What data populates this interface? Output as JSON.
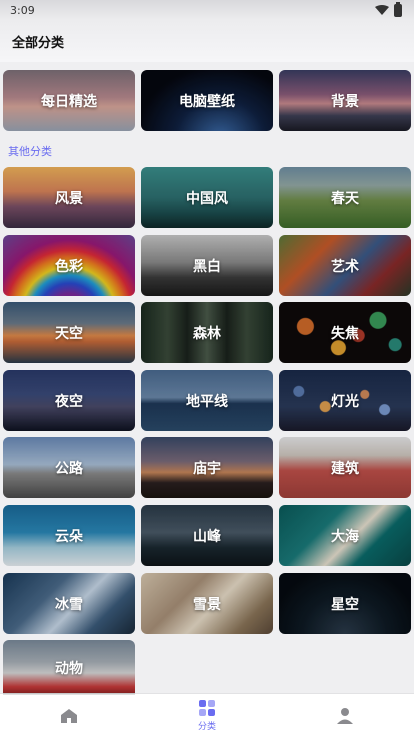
{
  "status_bar": {
    "time": "3:09"
  },
  "header": {
    "title": "全部分类"
  },
  "featured": [
    {
      "label": "每日精选"
    },
    {
      "label": "电脑壁纸"
    },
    {
      "label": "背景"
    }
  ],
  "section_label": "其他分类",
  "categories": [
    {
      "label": "风景"
    },
    {
      "label": "中国风"
    },
    {
      "label": "春天"
    },
    {
      "label": "色彩"
    },
    {
      "label": "黑白"
    },
    {
      "label": "艺术"
    },
    {
      "label": "天空"
    },
    {
      "label": "森林"
    },
    {
      "label": "失焦"
    },
    {
      "label": "夜空"
    },
    {
      "label": "地平线"
    },
    {
      "label": "灯光"
    },
    {
      "label": "公路"
    },
    {
      "label": "庙宇"
    },
    {
      "label": "建筑"
    },
    {
      "label": "云朵"
    },
    {
      "label": "山峰"
    },
    {
      "label": "大海"
    },
    {
      "label": "冰雪"
    },
    {
      "label": "雪景"
    },
    {
      "label": "星空"
    },
    {
      "label": "动物"
    }
  ],
  "tabbar": {
    "items": [
      {
        "icon": "home-icon",
        "label": ""
      },
      {
        "icon": "grid-icon",
        "label": "分类",
        "active": true
      },
      {
        "icon": "person-icon",
        "label": ""
      }
    ],
    "accent": "#6a6cf0"
  }
}
